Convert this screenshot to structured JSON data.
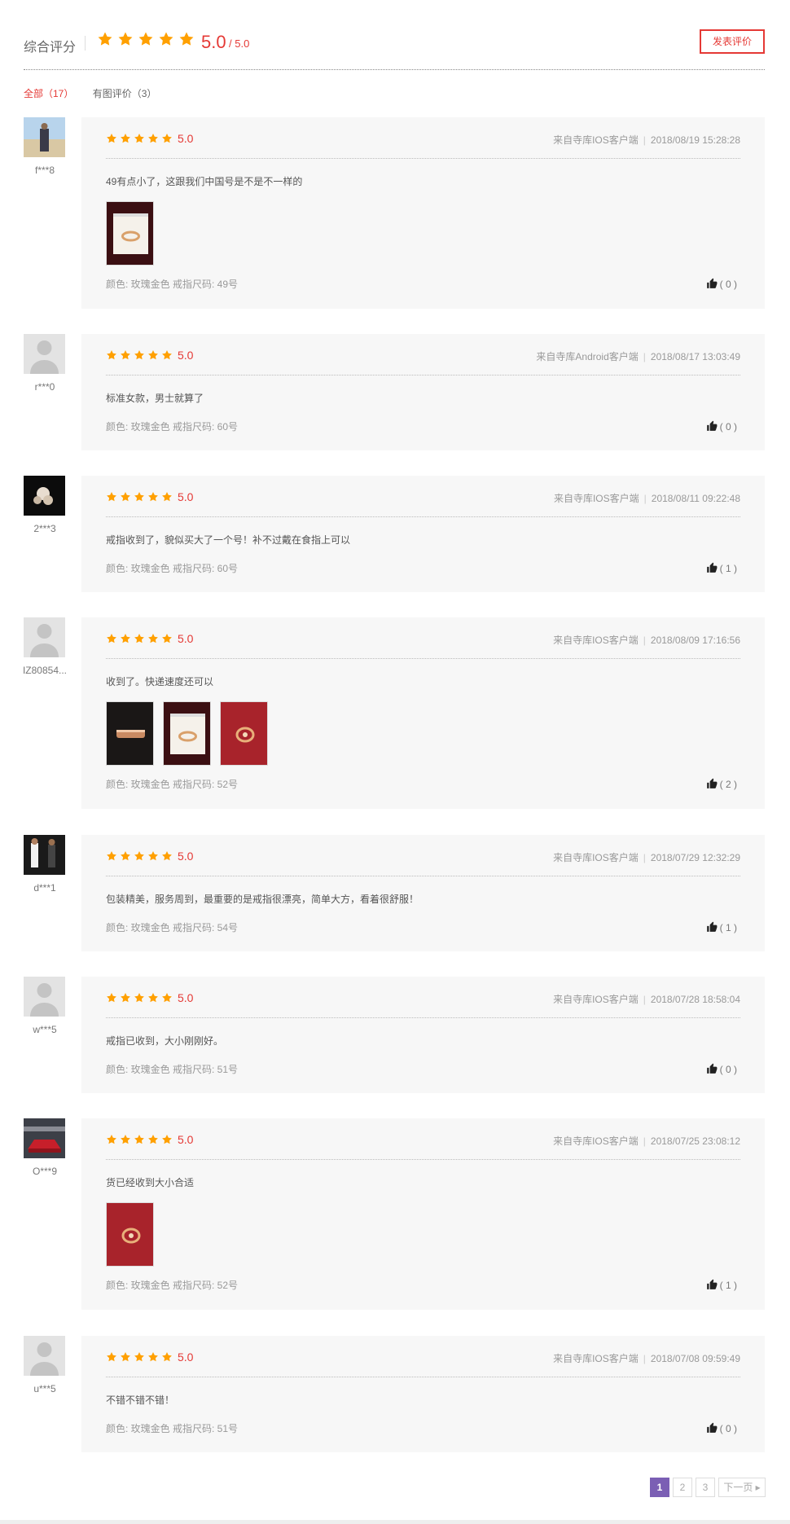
{
  "colors": {
    "accent": "#e53935",
    "star": "#ffa000",
    "pager_active": "#7b5fb4"
  },
  "summary": {
    "title": "综合评分",
    "score": "5.0",
    "score_max": "/ 5.0",
    "write_button": "发表评价"
  },
  "filters": [
    {
      "label": "全部（17）",
      "active": true
    },
    {
      "label": "有图评价（3）",
      "active": false
    }
  ],
  "reviews": [
    {
      "user": "f***8",
      "avatar": "photo",
      "stars": 5,
      "score": "5.0",
      "source": "来自寺库IOS客户端",
      "date": "2018/08/19 15:28:28",
      "content": "49有点小了，这跟我们中国号是不是不一样的",
      "photos": [
        "ring-box-photo"
      ],
      "spec": "颜色: 玫瑰金色 戒指尺码: 49号",
      "likes": "( 0 )"
    },
    {
      "user": "r***0",
      "avatar": "default",
      "stars": 5,
      "score": "5.0",
      "source": "来自寺库Android客户端",
      "date": "2018/08/17 13:03:49",
      "content": "标准女款，男士就算了",
      "photos": [],
      "spec": "颜色: 玫瑰金色 戒指尺码: 60号",
      "likes": "( 0 )"
    },
    {
      "user": "2***3",
      "avatar": "photo",
      "stars": 5,
      "score": "5.0",
      "source": "来自寺库IOS客户端",
      "date": "2018/08/11 09:22:48",
      "content": "戒指收到了，貌似买大了一个号！补不过戴在食指上可以",
      "photos": [],
      "spec": "颜色: 玫瑰金色 戒指尺码: 60号",
      "likes": "( 1 )"
    },
    {
      "user": "IZ80854...",
      "avatar": "default",
      "stars": 5,
      "score": "5.0",
      "source": "来自寺库IOS客户端",
      "date": "2018/08/09 17:16:56",
      "content": "收到了。快递速度还可以",
      "photos": [
        "ring-dark-photo",
        "ring-box-photo",
        "ring-red-photo"
      ],
      "spec": "颜色: 玫瑰金色 戒指尺码: 52号",
      "likes": "( 2 )"
    },
    {
      "user": "d***1",
      "avatar": "photo",
      "stars": 5,
      "score": "5.0",
      "source": "来自寺库IOS客户端",
      "date": "2018/07/29 12:32:29",
      "content": "包装精美，服务周到，最重要的是戒指很漂亮，简单大方，看着很舒服！",
      "photos": [],
      "spec": "颜色: 玫瑰金色 戒指尺码: 54号",
      "likes": "( 1 )"
    },
    {
      "user": "w***5",
      "avatar": "default",
      "stars": 5,
      "score": "5.0",
      "source": "来自寺库IOS客户端",
      "date": "2018/07/28 18:58:04",
      "content": "戒指已收到，大小刚刚好。",
      "photos": [],
      "spec": "颜色: 玫瑰金色 戒指尺码: 51号",
      "likes": "( 0 )"
    },
    {
      "user": "O***9",
      "avatar": "photo",
      "stars": 5,
      "score": "5.0",
      "source": "来自寺库IOS客户端",
      "date": "2018/07/25 23:08:12",
      "content": "货已经收到大小合适",
      "photos": [
        "ring-red-photo"
      ],
      "spec": "颜色: 玫瑰金色 戒指尺码: 52号",
      "likes": "( 1 )"
    },
    {
      "user": "u***5",
      "avatar": "default",
      "stars": 5,
      "score": "5.0",
      "source": "来自寺库IOS客户端",
      "date": "2018/07/08 09:59:49",
      "content": "不错不错不错！",
      "photos": [],
      "spec": "颜色: 玫瑰金色 戒指尺码: 51号",
      "likes": "( 0 )"
    }
  ],
  "pagination": {
    "pages": [
      "1",
      "2",
      "3"
    ],
    "current": "1",
    "next": "下一页"
  }
}
